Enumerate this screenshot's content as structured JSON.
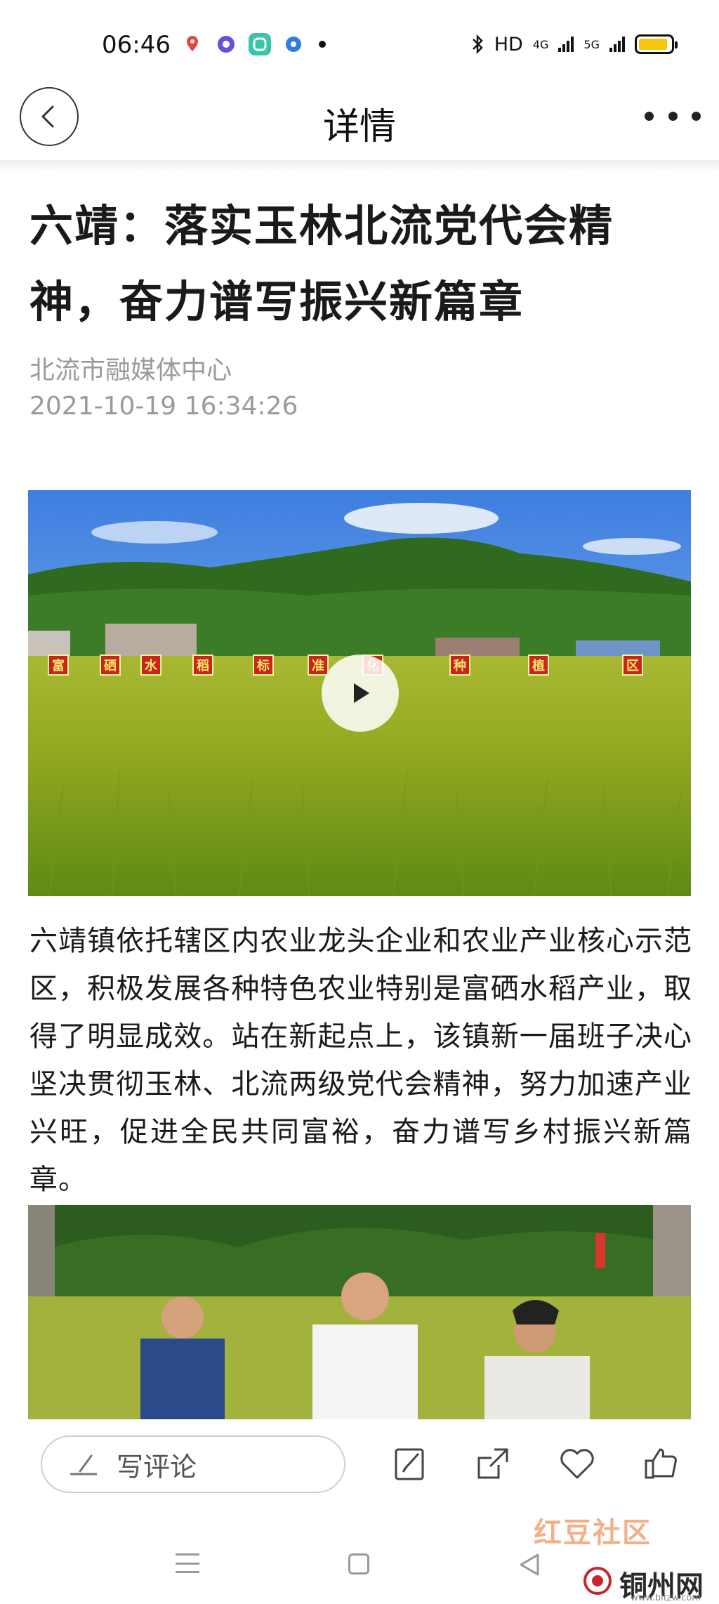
{
  "status_bar": {
    "time": "06:46",
    "network": "HD",
    "sim1": "4G",
    "sim2": "5G",
    "battery_level": 0.9,
    "battery_color": "#f4c70f"
  },
  "nav": {
    "title": "详情",
    "back_icon": "back-arrow-icon",
    "more_icon": "more-dots-icon"
  },
  "article": {
    "headline": "六靖：落实玉林北流党代会精神，奋力谱写振兴新篇章",
    "source": "北流市融媒体中心",
    "datetime": "2021-10-19 16:34:26",
    "video_signs": [
      "富",
      "硒",
      "水",
      "稻",
      "标",
      "准",
      "化",
      "种",
      "植",
      "区"
    ],
    "body": "六靖镇依托辖区内农业龙头企业和农业产业核心示范区，积极发展各种特色农业特别是富硒水稻产业，取得了明显成效。站在新起点上，该镇新一届班子决心坚决贯彻玉林、北流两级党代会精神，努力加速产业兴旺，促进全民共同富裕，奋力谱写乡村振兴新篇章。"
  },
  "action_bar": {
    "comment_placeholder": "写评论",
    "icons": [
      "edit-icon",
      "share-icon",
      "like-heart-icon",
      "thumbs-up-icon"
    ]
  },
  "watermark": {
    "community": "红豆社区",
    "site": "铜州网",
    "url": "www.bltzw.com"
  }
}
